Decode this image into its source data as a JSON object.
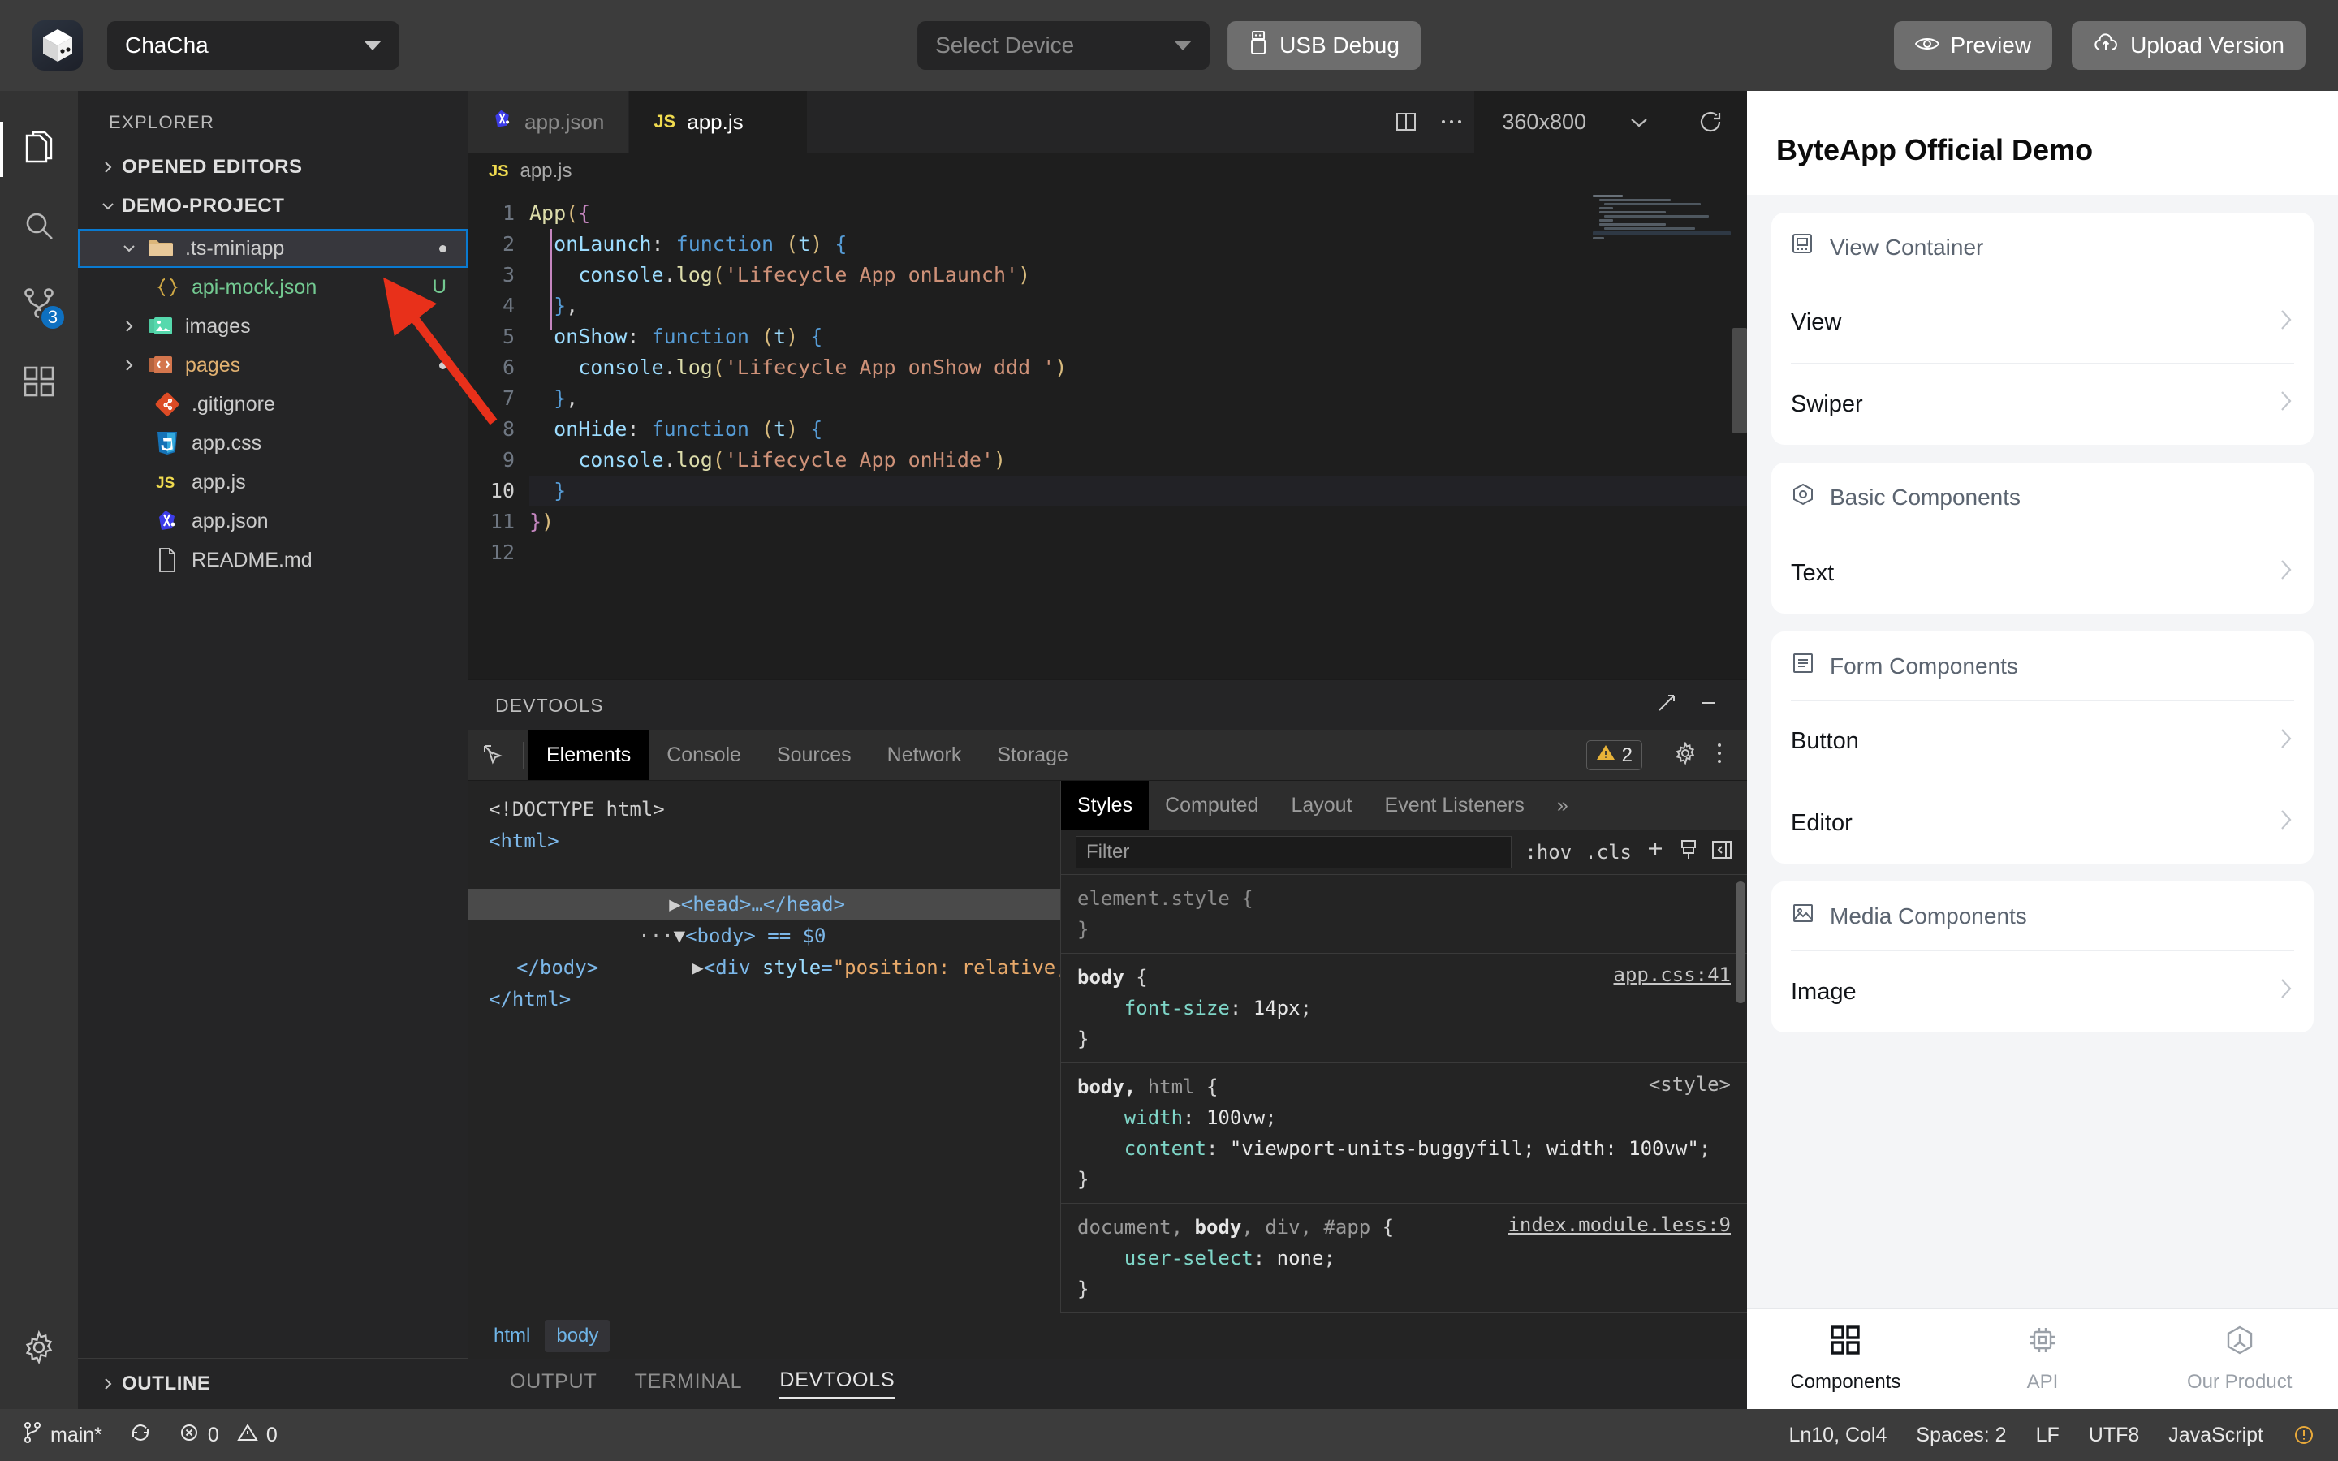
{
  "titlebar": {
    "logo_icon": "cube-logo-icon",
    "app_name": "ChaCha",
    "device_placeholder": "Select Device",
    "usb_debug_label": "USB Debug",
    "preview_label": "Preview",
    "upload_label": "Upload Version"
  },
  "activitybar": {
    "items": [
      {
        "name": "explorer",
        "icon": "files-icon"
      },
      {
        "name": "search",
        "icon": "search-icon"
      },
      {
        "name": "source-control",
        "icon": "source-control-icon",
        "badge": "3"
      },
      {
        "name": "extensions",
        "icon": "extensions-icon"
      }
    ],
    "settings_icon": "gear-icon"
  },
  "explorer": {
    "title": "EXPLORER",
    "sections": [
      {
        "label": "OPENED EDITORS",
        "expanded": false
      },
      {
        "label": "DEMO-PROJECT",
        "expanded": true
      }
    ],
    "outline_label": "OUTLINE",
    "tree": [
      {
        "label": ".ts-miniapp",
        "icon": "folder-icon",
        "indent": 1,
        "selected": true,
        "twisty": "down",
        "status": "dot"
      },
      {
        "label": "api-mock.json",
        "icon": "json-braces-icon",
        "indent": 2,
        "color": "#73c991",
        "status": "U"
      },
      {
        "label": "images",
        "icon": "folder-images-icon",
        "indent": 1,
        "twisty": "right"
      },
      {
        "label": "pages",
        "icon": "folder-pages-icon",
        "indent": 1,
        "twisty": "right",
        "color": "#e0b070",
        "status": "dot"
      },
      {
        "label": ".gitignore",
        "icon": "git-icon",
        "indent": 2
      },
      {
        "label": "app.css",
        "icon": "css-icon",
        "indent": 2
      },
      {
        "label": "app.js",
        "icon": "js-icon",
        "indent": 2
      },
      {
        "label": "app.json",
        "icon": "miniapp-json-icon",
        "indent": 2
      },
      {
        "label": "README.md",
        "icon": "markdown-icon",
        "indent": 2
      }
    ]
  },
  "editor": {
    "tabs": [
      {
        "label": "app.json",
        "icon": "miniapp-json-icon",
        "active": false
      },
      {
        "label": "app.js",
        "icon": "js-icon",
        "active": true
      }
    ],
    "split_icon": "split-editor-icon",
    "more_icon": "more-horizontal-icon",
    "device_size": "360x800",
    "device_chevron": "chevron-down-icon",
    "refresh_icon": "refresh-icon",
    "breadcrumb": {
      "icon": "js-icon",
      "label": "app.js"
    },
    "line_numbers": [
      "1",
      "2",
      "3",
      "4",
      "5",
      "6",
      "7",
      "8",
      "9",
      "10",
      "11",
      "12"
    ],
    "current_line": 10,
    "lines": [
      "App({",
      "  onLaunch: function (t) {",
      "    console.log('Lifecycle App onLaunch')",
      "  },",
      "  onShow: function (t) {",
      "    console.log('Lifecycle App onShow ddd ')",
      "  },",
      "  onHide: function (t) {",
      "    console.log('Lifecycle App onHide')",
      "  }",
      "})",
      ""
    ]
  },
  "devtools": {
    "panel_title": "DEVTOOLS",
    "expand_icon": "expand-icon",
    "minimize_icon": "minimize-icon",
    "inspect_icon": "inspect-element-icon",
    "tabs": [
      {
        "label": "Elements",
        "active": true
      },
      {
        "label": "Console",
        "active": false
      },
      {
        "label": "Sources",
        "active": false
      },
      {
        "label": "Network",
        "active": false
      },
      {
        "label": "Storage",
        "active": false
      }
    ],
    "warning_count": "2",
    "warning_icon": "warning-triangle-icon",
    "settings_icon": "gear-icon",
    "more_icon": "more-vertical-icon",
    "dom_lines": [
      {
        "text": "<!DOCTYPE html>",
        "kind": "doctype",
        "indent": 0
      },
      {
        "text": "<html>",
        "kind": "tag",
        "indent": 0
      },
      {
        "text": "<head>…</head>",
        "kind": "tag",
        "indent": 1,
        "twisty": "right"
      },
      {
        "text": "<body> == $0",
        "kind": "tag",
        "indent": 1,
        "twisty": "down",
        "selected": true,
        "ellipsis": true
      },
      {
        "text": "<div style=\"position: relative;\">…</div>",
        "kind": "tagattr",
        "indent": 2,
        "twisty": "right"
      },
      {
        "text": "</body>",
        "kind": "tag",
        "indent": 1
      },
      {
        "text": "</html>",
        "kind": "tag",
        "indent": 0
      }
    ],
    "crumbs": [
      {
        "label": "html",
        "active": false
      },
      {
        "label": "body",
        "active": true
      }
    ],
    "styles": {
      "tabs": [
        {
          "label": "Styles",
          "active": true
        },
        {
          "label": "Computed",
          "active": false
        },
        {
          "label": "Layout",
          "active": false
        },
        {
          "label": "Event Listeners",
          "active": false
        },
        {
          "label": "»",
          "active": false
        }
      ],
      "filter_placeholder": "Filter",
      "hov_label": ":hov",
      "cls_label": ".cls",
      "plus_icon": "add-rule-icon",
      "brush_icon": "brush-icon",
      "sidebar_icon": "toggle-sidebar-icon",
      "rules": [
        {
          "selector": "element.style",
          "selector_dim": "",
          "source": "",
          "declarations": [],
          "dim": true
        },
        {
          "selector": "body",
          "selector_dim": "",
          "source": "app.css:41",
          "source_link": true,
          "declarations": [
            {
              "prop": "font-size",
              "value": "14px"
            }
          ]
        },
        {
          "selector": "body,",
          "selector_dim": "html",
          "source": "<style>",
          "source_link": false,
          "declarations": [
            {
              "prop": "width",
              "value": "100vw"
            },
            {
              "prop": "content",
              "value": "\"viewport-units-buggyfill; width: 100vw\""
            }
          ]
        },
        {
          "selector": "document, body, div, #app",
          "selector_dim": "",
          "source": "index.module.less:9",
          "source_link": true,
          "declarations": [
            {
              "prop": "user-select",
              "value": "none"
            }
          ]
        }
      ]
    }
  },
  "panel_tabs": [
    {
      "label": "OUTPUT",
      "active": false
    },
    {
      "label": "TERMINAL",
      "active": false
    },
    {
      "label": "DEVTOOLS",
      "active": true
    }
  ],
  "preview": {
    "title": "ByteApp Official Demo",
    "groups": [
      {
        "header": "View Container",
        "header_icon": "view-container-icon",
        "rows": [
          "View",
          "Swiper"
        ]
      },
      {
        "header": "Basic Components",
        "header_icon": "basic-components-icon",
        "rows": [
          "Text"
        ]
      },
      {
        "header": "Form Components",
        "header_icon": "form-components-icon",
        "rows": [
          "Button",
          "Editor"
        ]
      },
      {
        "header": "Media Components",
        "header_icon": "media-components-icon",
        "rows": [
          "Image"
        ]
      }
    ],
    "tabbar": [
      {
        "label": "Components",
        "icon": "grid-icon",
        "active": true
      },
      {
        "label": "API",
        "icon": "chip-icon",
        "active": false
      },
      {
        "label": "Our Product",
        "icon": "hexagon-icon",
        "active": false
      }
    ]
  },
  "statusbar": {
    "branch_icon": "git-branch-icon",
    "branch": "main*",
    "sync_icon": "sync-icon",
    "error_icon": "error-circle-icon",
    "errors": "0",
    "warning_icon": "warning-triangle-icon",
    "warnings": "0",
    "cursor": "Ln10, Col4",
    "spaces": "Spaces: 2",
    "eol": "LF",
    "encoding": "UTF8",
    "language": "JavaScript",
    "bell_icon": "notification-icon"
  },
  "annotation": {
    "arrow_color": "#e8301a"
  }
}
